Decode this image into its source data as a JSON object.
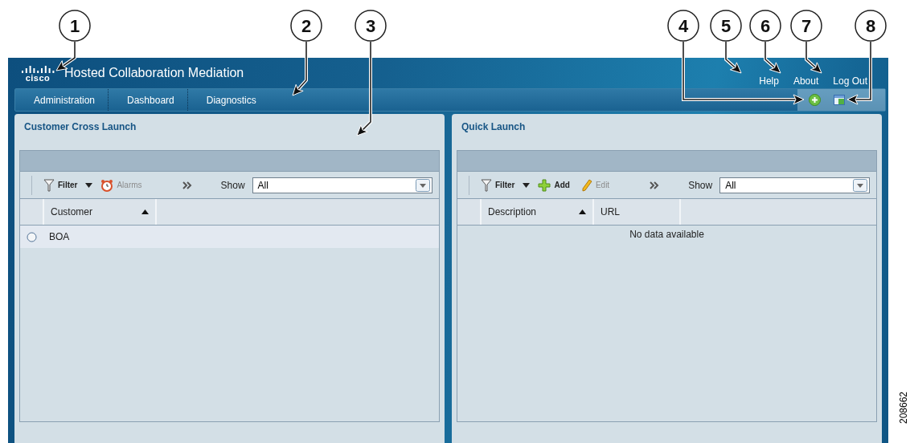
{
  "callouts": [
    "1",
    "2",
    "3",
    "4",
    "5",
    "6",
    "7",
    "8"
  ],
  "header": {
    "logo_text": "cisco",
    "title": "Hosted Collaboration Mediation",
    "links": [
      "Help",
      "About",
      "Log Out"
    ]
  },
  "nav": {
    "tabs": [
      "Administration",
      "Dashboard",
      "Diagnostics"
    ]
  },
  "panels": [
    {
      "title": "Customer Cross Launch",
      "toolbar": [
        {
          "kind": "filter",
          "label": "Filter",
          "disabled": false
        },
        {
          "kind": "alarms",
          "label": "Alarms",
          "disabled": true
        }
      ],
      "show_label": "Show",
      "show_value": "All",
      "columns": [
        {
          "label": "Customer",
          "sorted": true
        }
      ],
      "rows": [
        {
          "cells": [
            "BOA"
          ],
          "selected": false
        }
      ]
    },
    {
      "title": "Quick Launch",
      "toolbar": [
        {
          "kind": "filter",
          "label": "Filter",
          "disabled": false
        },
        {
          "kind": "add",
          "label": "Add",
          "disabled": false
        },
        {
          "kind": "edit",
          "label": "Edit",
          "disabled": true
        }
      ],
      "show_label": "Show",
      "show_value": "All",
      "columns": [
        {
          "label": "Description",
          "sorted": true
        },
        {
          "label": "URL",
          "sorted": false
        }
      ],
      "empty_text": "No data available"
    }
  ],
  "figure_id": "208662"
}
